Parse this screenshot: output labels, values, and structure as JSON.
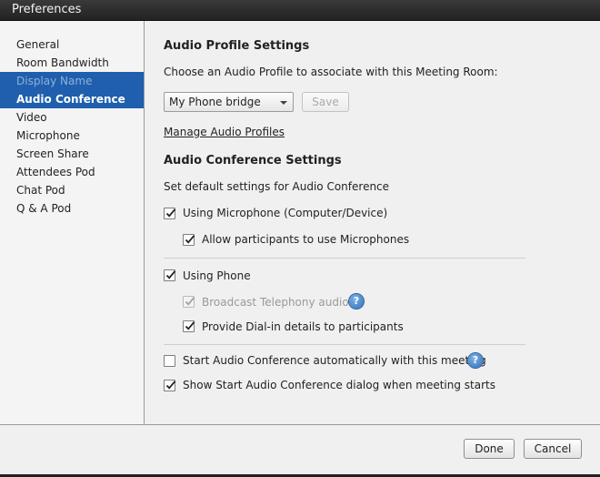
{
  "window": {
    "title": "Preferences"
  },
  "sidebar": {
    "items": [
      {
        "label": "General"
      },
      {
        "label": "Room Bandwidth"
      },
      {
        "label": "Display Name"
      },
      {
        "label": "Audio Conference"
      },
      {
        "label": "Video"
      },
      {
        "label": "Microphone"
      },
      {
        "label": "Screen Share"
      },
      {
        "label": "Attendees Pod"
      },
      {
        "label": "Chat Pod"
      },
      {
        "label": "Q & A Pod"
      }
    ],
    "selected": "Audio Conference"
  },
  "profile": {
    "heading": "Audio Profile Settings",
    "prompt": "Choose an Audio Profile to associate with this Meeting Room:",
    "selected_profile": "My Phone bridge",
    "save_label": "Save",
    "manage_link": "Manage Audio Profiles"
  },
  "conference": {
    "heading": "Audio Conference Settings",
    "description": "Set default settings for Audio Conference",
    "using_microphone": {
      "label": "Using Microphone (Computer/Device)",
      "checked": true
    },
    "allow_microphones": {
      "label": "Allow participants to use Microphones",
      "checked": true
    },
    "using_phone": {
      "label": "Using Phone",
      "checked": true
    },
    "broadcast_telephony": {
      "label": "Broadcast Telephony audio",
      "checked": true,
      "disabled": true
    },
    "provide_dialin": {
      "label": "Provide Dial-in details to participants",
      "checked": true
    },
    "start_automatically": {
      "label": "Start Audio Conference automatically with this meeting",
      "checked": false
    },
    "show_start_dialog": {
      "label": "Show Start Audio Conference dialog when meeting starts",
      "checked": true
    },
    "help_glyph": "?"
  },
  "footer": {
    "done_label": "Done",
    "cancel_label": "Cancel"
  }
}
